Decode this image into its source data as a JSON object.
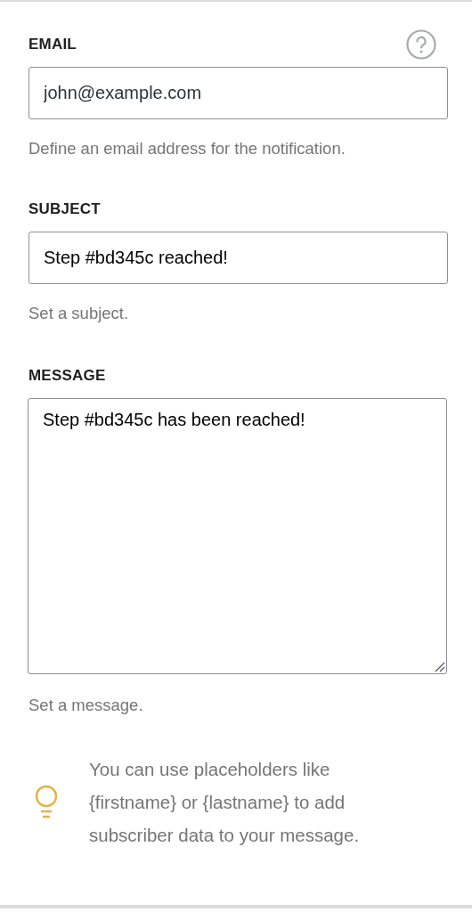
{
  "fields": [
    {
      "kind": "input",
      "label": "EMAIL",
      "help_button": true,
      "placeholder": "john@example.com",
      "help": "Define an email address for the notification."
    },
    {
      "kind": "input",
      "label": "SUBJECT",
      "help_button": false,
      "value": "Step #bd345c reached!",
      "help": "Set a subject."
    },
    {
      "kind": "textarea",
      "label": "MESSAGE",
      "help_button": false,
      "value": "Step #bd345c has been reached!",
      "help": "Set a message."
    }
  ],
  "tip": {
    "text": "You can use placeholders like {firstname} or {lastname} to add subscriber data to your message."
  }
}
